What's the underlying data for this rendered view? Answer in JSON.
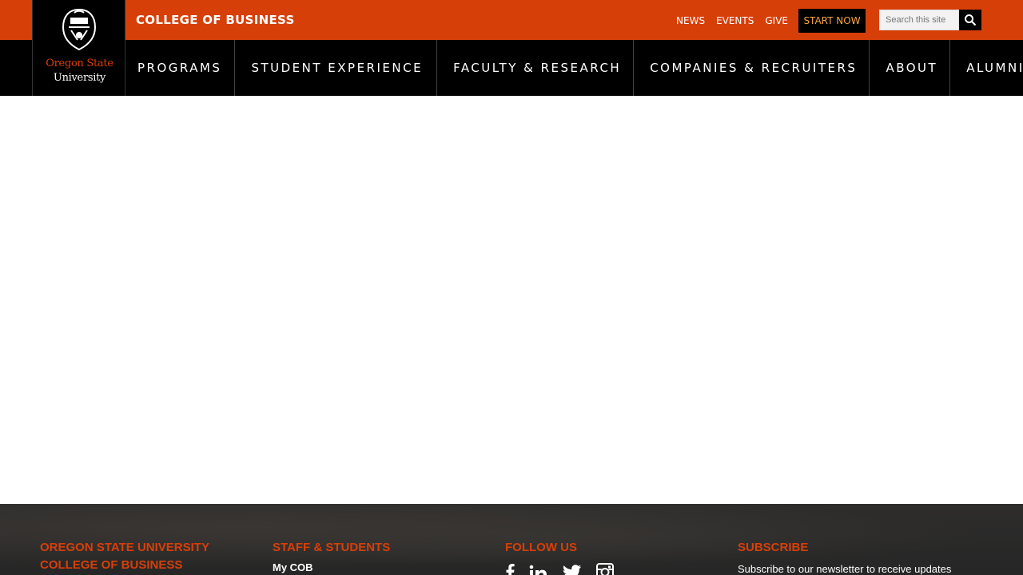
{
  "header": {
    "college_title": "COLLEGE OF BUSINESS",
    "utility_links": [
      "NEWS",
      "EVENTS",
      "GIVE"
    ],
    "start_now": "START NOW",
    "search_placeholder": "Search this site"
  },
  "logo": {
    "line1": "Oregon State",
    "line2": "University"
  },
  "nav": {
    "items": [
      "PROGRAMS",
      "STUDENT EXPERIENCE",
      "FACULTY & RESEARCH",
      "COMPANIES & RECRUITERS",
      "ABOUT",
      "ALUMNI"
    ]
  },
  "footer": {
    "col1_line1": "OREGON STATE UNIVERSITY",
    "col1_line2": "COLLEGE OF BUSINESS",
    "col2_heading": "STAFF & STUDENTS",
    "col2_link": "My COB",
    "col3_heading": "FOLLOW US",
    "col4_heading": "SUBSCRIBE",
    "col4_text": "Subscribe to our newsletter to receive updates"
  },
  "colors": {
    "brand_orange": "#d73f09",
    "nav_black": "#000000",
    "start_now_text": "#f7a541"
  },
  "icons": [
    "osu-seal-icon",
    "search-icon",
    "facebook-icon",
    "linkedin-icon",
    "twitter-icon",
    "instagram-icon"
  ]
}
